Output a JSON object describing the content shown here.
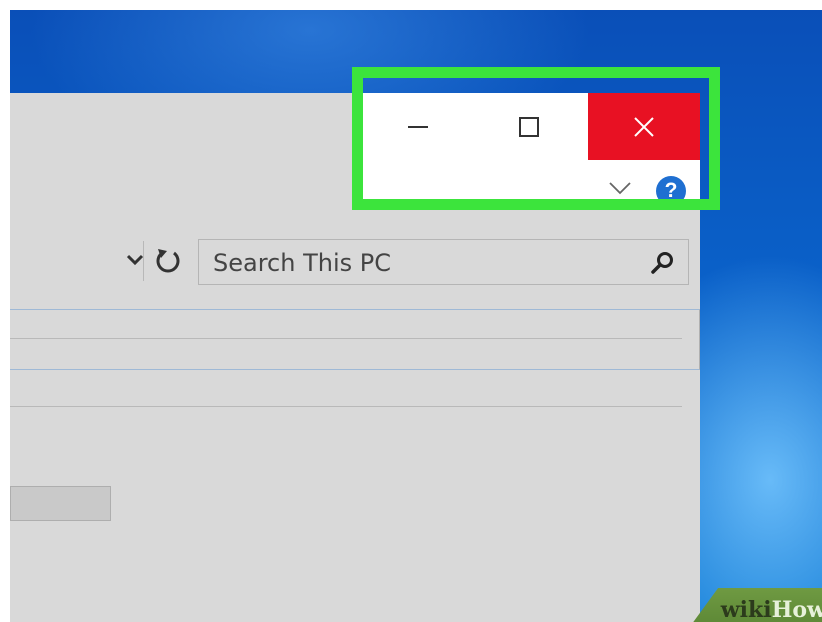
{
  "window": {
    "caption_buttons": {
      "minimize_icon": "minimize-icon",
      "maximize_icon": "maximize-icon",
      "close_icon": "close-icon",
      "close_color": "#e81123"
    },
    "ribbon_toggle_icon": "chevron-down-icon",
    "help": {
      "label": "?",
      "color": "#1f6fd1"
    }
  },
  "toolbar": {
    "address_dropdown_icon": "chevron-down-icon",
    "refresh_icon": "refresh-icon",
    "search": {
      "placeholder": "Search This PC",
      "icon": "search-icon"
    }
  },
  "highlight": {
    "color": "#3ce43c"
  },
  "watermark": {
    "wiki": "wiki",
    "how": "How"
  }
}
